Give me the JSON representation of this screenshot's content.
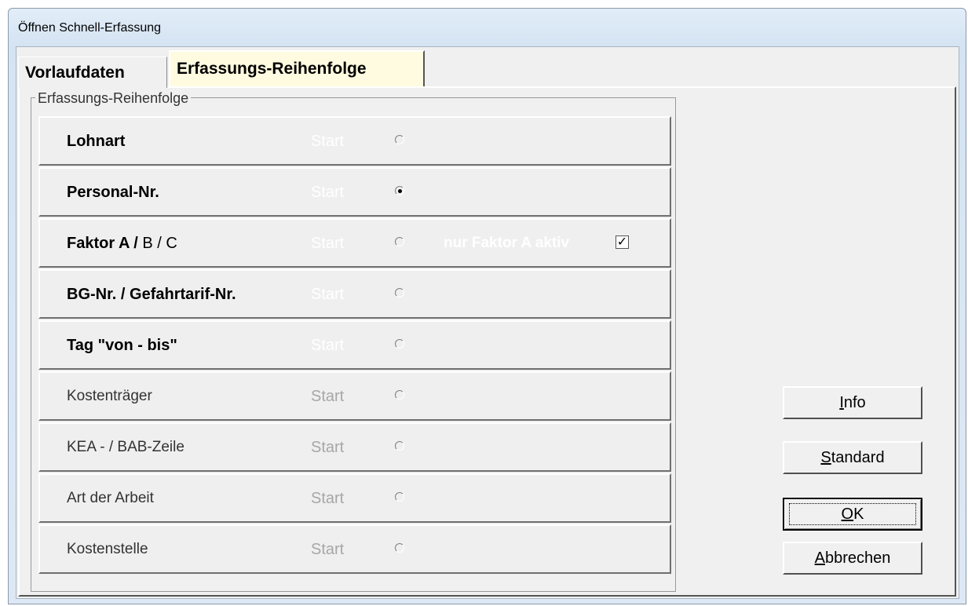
{
  "window": {
    "title": "Öffnen Schnell-Erfassung"
  },
  "tabs": [
    {
      "label": "Vorlaufdaten",
      "active": false
    },
    {
      "label": "Erfassungs-Reihenfolge",
      "active": true
    }
  ],
  "group": {
    "title": "Erfassungs-Reihenfolge",
    "rows": [
      {
        "label": "Lohnart",
        "start": "Start",
        "selected": false,
        "bold": true
      },
      {
        "label": "Personal-Nr.",
        "start": "Start",
        "selected": true,
        "bold": true
      },
      {
        "label": "Faktor A /",
        "label_suffix": "B / C",
        "start": "Start",
        "selected": false,
        "bold": true,
        "extra": {
          "label": "nur Faktor A aktiv",
          "checked": true
        }
      },
      {
        "label": "BG-Nr. / Gefahrtarif-Nr.",
        "start": "Start",
        "selected": false,
        "bold": true
      },
      {
        "label": "Tag  \"von - bis\"",
        "start": "Start",
        "selected": false,
        "bold": true
      },
      {
        "label": "Kostenträger",
        "start": "Start",
        "selected": false,
        "bold": false
      },
      {
        "label": "KEA - / BAB-Zeile",
        "start": "Start",
        "selected": false,
        "bold": false
      },
      {
        "label": "Art der Arbeit",
        "start": "Start",
        "selected": false,
        "bold": false
      },
      {
        "label": "Kostenstelle",
        "start": "Start",
        "selected": false,
        "bold": false
      }
    ]
  },
  "buttons": {
    "info": {
      "mnemonic": "I",
      "rest": "nfo"
    },
    "standard": {
      "mnemonic": "S",
      "rest": "tandard"
    },
    "ok": {
      "mnemonic": "O",
      "rest": "K"
    },
    "cancel": {
      "mnemonic": "A",
      "rest": "bbrechen"
    }
  },
  "colors": {
    "active_tab_bg": "#fffbe0",
    "start_bold_rows": "#ffffff",
    "start_normal_rows": "#a7a7a7"
  },
  "icons": {
    "radio": "radio-button-icon",
    "check": "checkbox-checked-icon"
  }
}
